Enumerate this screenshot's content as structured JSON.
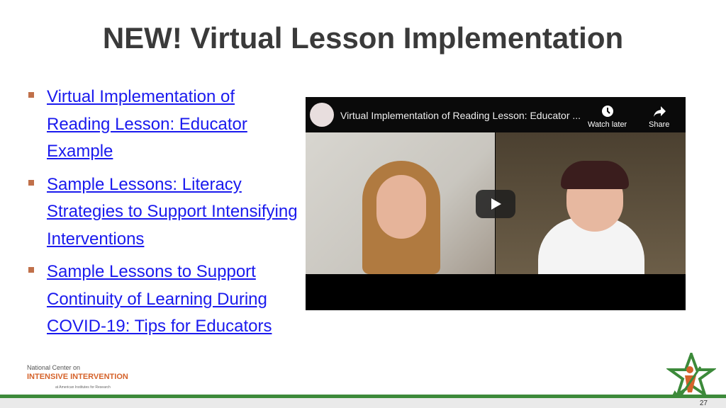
{
  "slide": {
    "title": "NEW! Virtual Lesson Implementation",
    "page_number": "27"
  },
  "links": [
    {
      "label": "Virtual Implementation of Reading Lesson: Educator Example"
    },
    {
      "label": "Sample Lessons: Literacy Strategies to Support Intensifying Interventions"
    },
    {
      "label": "Sample Lessons to Support Continuity of Learning During COVID-19: Tips for Educators"
    }
  ],
  "video": {
    "title": "Virtual Implementation of Reading Lesson: Educator ...",
    "watch_later": "Watch later",
    "share": "Share",
    "icons": [
      "clock-icon",
      "share-arrow-icon",
      "play-icon"
    ]
  },
  "logo": {
    "line1": "National Center on",
    "line2": "INTENSIVE INTERVENTION",
    "line3": "at American Institutes for Research"
  },
  "colors": {
    "link": "#1a1aee",
    "bullet": "#c0704a",
    "footer_bar": "#3c8a3a",
    "logo_orange": "#d5622a"
  }
}
